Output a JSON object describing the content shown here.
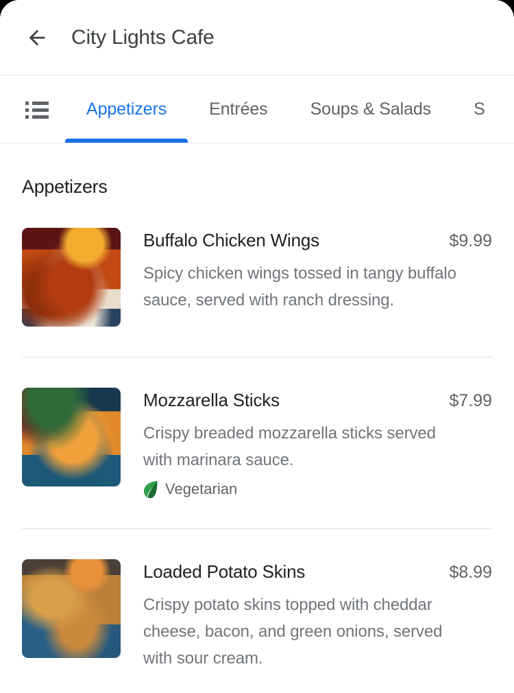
{
  "appbar": {
    "back_icon": "arrow-back-icon",
    "title": "City Lights Cafe"
  },
  "tabstrip": {
    "list_icon": "list-view-icon",
    "tabs": [
      {
        "label": "Appetizers",
        "active": true
      },
      {
        "label": "Entrées",
        "active": false
      },
      {
        "label": "Soups & Salads",
        "active": false
      },
      {
        "label": "S",
        "active": false
      }
    ],
    "active_color": "#1a73e8",
    "inactive_color": "#5f6368"
  },
  "menu": {
    "section_title": "Appetizers",
    "items": [
      {
        "name": "Buffalo Chicken Wings",
        "price": "$9.99",
        "description": "Spicy chicken wings tossed in tangy buffalo sauce, served with ranch dressing.",
        "tags": [],
        "image": "buffalo-chicken-wings-photo"
      },
      {
        "name": "Mozzarella Sticks",
        "price": "$7.99",
        "description": "Crispy breaded mozzarella sticks served with marinara sauce.",
        "tags": [
          {
            "icon": "leaf-icon",
            "label": "Vegetarian"
          }
        ],
        "image": "mozzarella-sticks-photo"
      },
      {
        "name": "Loaded Potato Skins",
        "price": "$8.99",
        "description": "Crispy potato skins topped with cheddar cheese, bacon, and green onions, served with sour cream.",
        "tags": [],
        "image": "loaded-potato-skins-photo"
      }
    ]
  }
}
